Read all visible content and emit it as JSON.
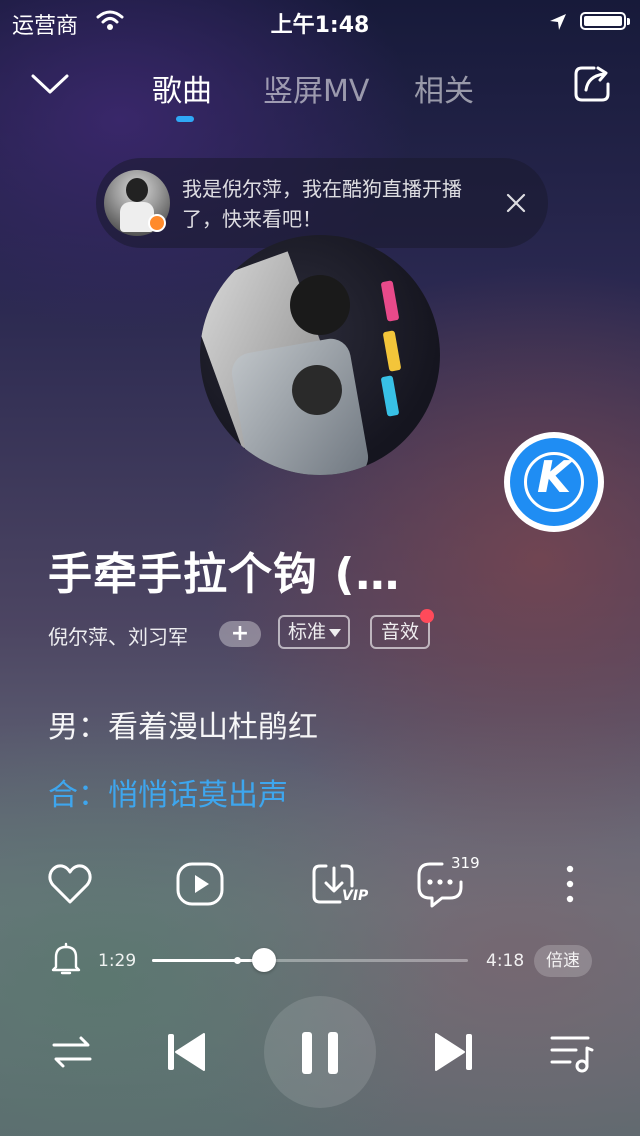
{
  "status_bar": {
    "carrier": "运营商",
    "time": "上午1:48"
  },
  "header": {
    "tabs": [
      {
        "label": "歌曲",
        "active": true
      },
      {
        "label": "竖屏MV",
        "active": false
      },
      {
        "label": "相关",
        "active": false
      }
    ]
  },
  "live_banner": {
    "text": "我是倪尔萍，我在酷狗直播开播了，快来看吧！"
  },
  "song": {
    "title": "手牵手拉个钩 (…",
    "artists": "倪尔萍、刘习军",
    "add_label": "+",
    "quality_label": "标准",
    "effect_label": "音效"
  },
  "lyrics": {
    "current": "男：看着漫山杜鹃红",
    "next": "合：悄悄话莫出声"
  },
  "actions": {
    "download_badge": "VIP",
    "comment_count": "319"
  },
  "progress": {
    "elapsed": "1:29",
    "total": "4:18",
    "fraction": 0.355,
    "speed_label": "倍速"
  },
  "brand": {
    "kugou_letter": "K",
    "accent": "#2fa8f6",
    "lyric_highlight": "#3ea6ee",
    "kugou_blue": "#1f8df3",
    "notice_dot": "#ff4a5a"
  },
  "icons": {
    "nav": [
      "chevron-down-icon",
      "share-icon"
    ],
    "actions": [
      "heart-icon",
      "play-video-icon",
      "download-icon",
      "comment-icon",
      "more-icon"
    ],
    "controls": [
      "repeat-icon",
      "previous-icon",
      "pause-icon",
      "next-icon",
      "playlist-icon"
    ]
  }
}
